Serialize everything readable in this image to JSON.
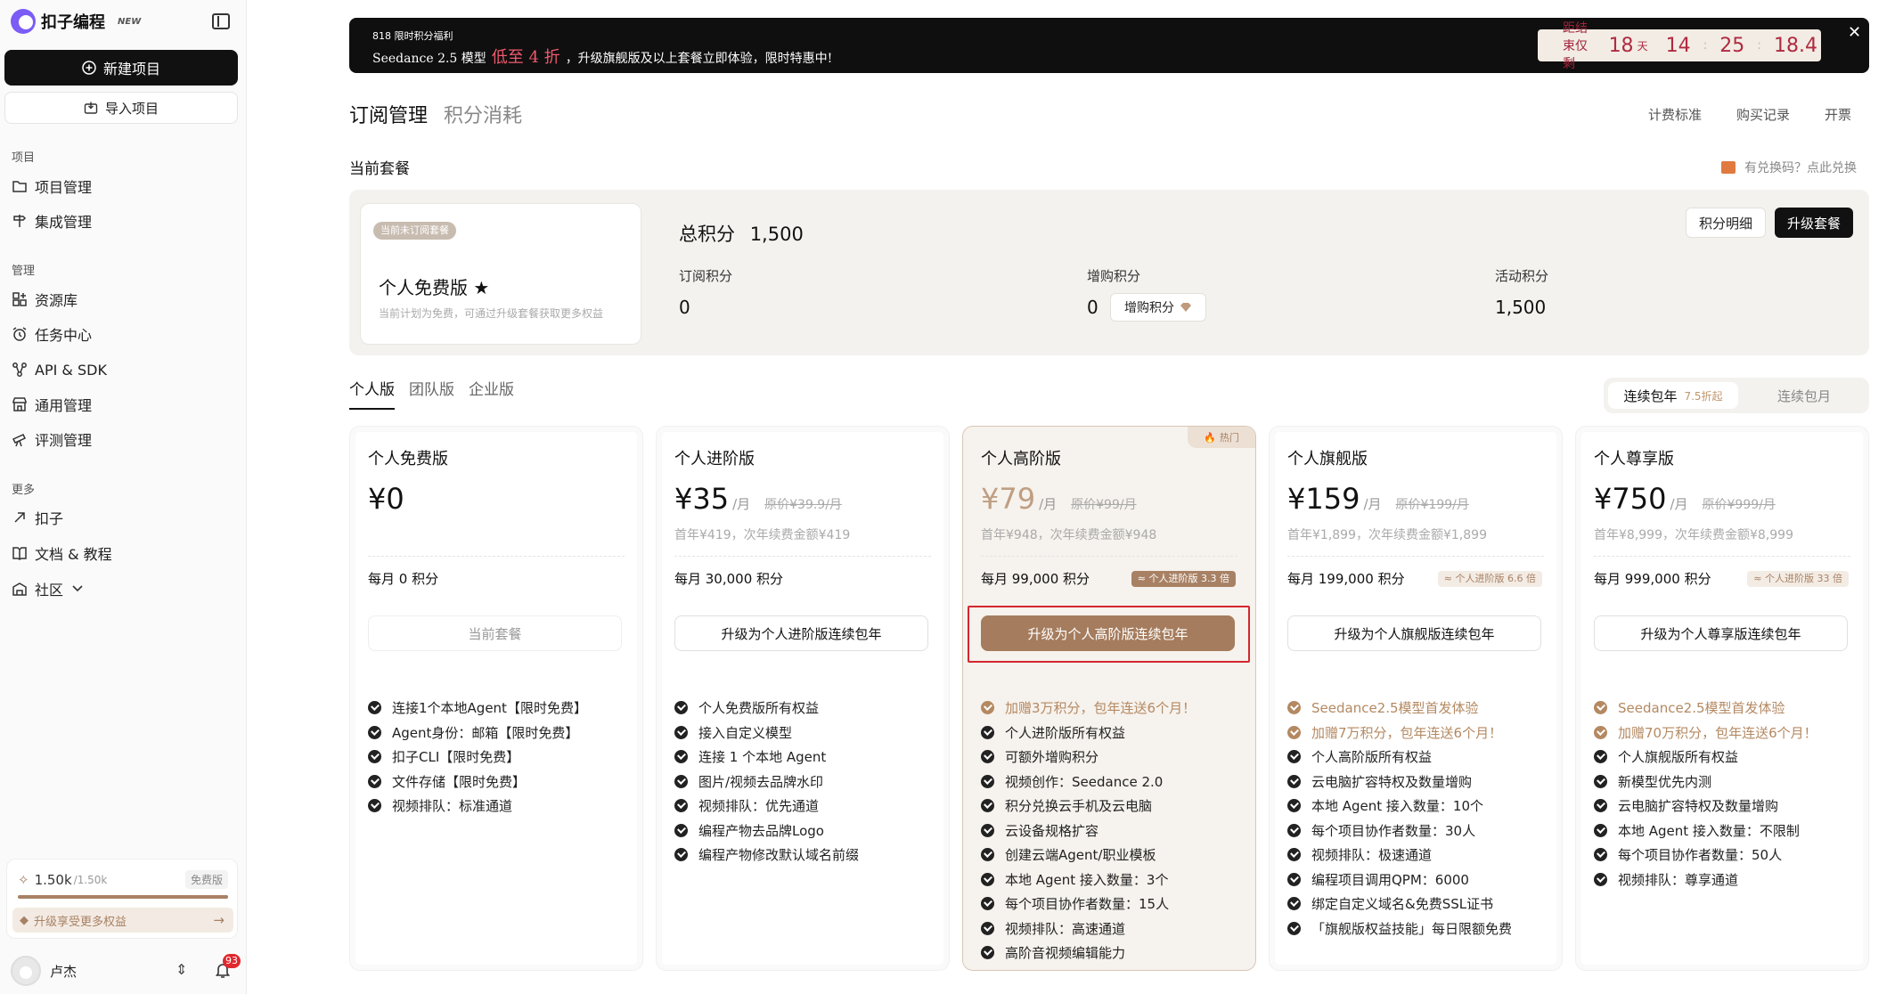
{
  "sidebar": {
    "brand": "扣子编程",
    "brand_badge": "NEW",
    "new_project": "新建项目",
    "import_project": "导入项目",
    "sections": [
      {
        "label": "项目",
        "items": [
          {
            "label": "项目管理",
            "icon": "folder-icon"
          },
          {
            "label": "集成管理",
            "icon": "signpost-icon"
          }
        ]
      },
      {
        "label": "管理",
        "items": [
          {
            "label": "资源库",
            "icon": "grid-plus-icon"
          },
          {
            "label": "任务中心",
            "icon": "alarm-clock-icon"
          },
          {
            "label": "API & SDK",
            "icon": "api-icon"
          },
          {
            "label": "通用管理",
            "icon": "storefront-icon"
          },
          {
            "label": "评测管理",
            "icon": "telescope-icon"
          }
        ]
      },
      {
        "label": "更多",
        "items": [
          {
            "label": "扣子",
            "icon": "arrow-up-right-icon"
          },
          {
            "label": "文档 & 教程",
            "icon": "book-open-icon"
          },
          {
            "label": "社区",
            "icon": "community-icon"
          }
        ]
      }
    ],
    "credits": {
      "used": "1.50k",
      "total": "/1.50k",
      "plan_tag": "免费版",
      "fill_fraction": 1.0,
      "upgrade_text": "升级享受更多权益"
    },
    "user": {
      "name": "卢杰",
      "notifications": "93"
    }
  },
  "banner": {
    "small_text": "818 限时积分福利",
    "line_prefix": "Seedance 2.5 模型",
    "line_highlight": "低至 4 折",
    "line_suffix": "，升级旗舰版及以上套餐立即体验，限时特惠中!",
    "timer_label": "距结束仅剩",
    "days": "18",
    "days_unit": "天",
    "hours": "14",
    "minutes": "25",
    "seconds": "18.4"
  },
  "page_tabs": {
    "active": "订阅管理",
    "inactive": "积分消耗"
  },
  "top_links": [
    "计费标准",
    "购买记录",
    "开票"
  ],
  "current_section": {
    "label": "当前套餐",
    "redeem": "有兑换码？点此兑换"
  },
  "current_plan": {
    "tag": "当前未订阅套餐",
    "title": "个人免费版 ★",
    "desc": "当前计划为免费，可通过升级套餐获取更多权益",
    "total_label": "总积分",
    "total_value": "1,500",
    "metrics": [
      {
        "label": "订阅积分",
        "value": "0"
      },
      {
        "label": "增购积分",
        "value": "0"
      },
      {
        "label": "活动积分",
        "value": "1,500"
      }
    ],
    "buy_button": "增购积分",
    "detail_button": "积分明细",
    "upgrade_button": "升级套餐"
  },
  "version_tabs": [
    "个人版",
    "团队版",
    "企业版"
  ],
  "billing": {
    "annual": "连续包年",
    "annual_discount": "7.5折起",
    "monthly": "连续包月"
  },
  "plans": [
    {
      "name": "个人免费版",
      "price": "¥0",
      "per": "",
      "orig": "",
      "renew": "",
      "points": "每月 0 积分",
      "mult": "",
      "cta": "当前套餐",
      "features": [
        {
          "t": "连接1个本地Agent【限时免费】",
          "a": false
        },
        {
          "t": "Agent身份：邮箱【限时免费】",
          "a": false
        },
        {
          "t": "扣子CLI【限时免费】",
          "a": false
        },
        {
          "t": "文件存储【限时免费】",
          "a": false
        },
        {
          "t": "视频排队：标准通道",
          "a": false
        }
      ]
    },
    {
      "name": "个人进阶版",
      "price": "¥35",
      "per": "/月",
      "orig": "原价¥39.9/月",
      "renew": "首年¥419，次年续费金额¥419",
      "points": "每月 30,000 积分",
      "mult": "",
      "cta": "升级为个人进阶版连续包年",
      "features": [
        {
          "t": "个人免费版所有权益",
          "a": false
        },
        {
          "t": "接入自定义模型",
          "a": false
        },
        {
          "t": "连接 1 个本地 Agent",
          "a": false
        },
        {
          "t": "图片/视频去品牌水印",
          "a": false
        },
        {
          "t": "视频排队：优先通道",
          "a": false
        },
        {
          "t": "编程产物去品牌Logo",
          "a": false
        },
        {
          "t": "编程产物修改默认域名前缀",
          "a": false
        }
      ]
    },
    {
      "name": "个人高阶版",
      "price": "¥79",
      "per": "/月",
      "orig": "原价¥99/月",
      "renew": "首年¥948，次年续费金额¥948",
      "points": "每月 99,000 积分",
      "mult": "≈ 个人进阶版 3.3 倍",
      "cta": "升级为个人高阶版连续包年",
      "hot": "热门",
      "features": [
        {
          "t": "加赠3万积分，包年连送6个月！",
          "a": true
        },
        {
          "t": "个人进阶版所有权益",
          "a": false
        },
        {
          "t": "可额外增购积分",
          "a": false
        },
        {
          "t": "视频创作：Seedance 2.0",
          "a": false
        },
        {
          "t": "积分兑换云手机及云电脑",
          "a": false
        },
        {
          "t": "云设备规格扩容",
          "a": false
        },
        {
          "t": "创建云端Agent/职业模板",
          "a": false
        },
        {
          "t": "本地 Agent 接入数量：3个",
          "a": false
        },
        {
          "t": "每个项目协作者数量：15人",
          "a": false
        },
        {
          "t": "视频排队：高速通道",
          "a": false
        },
        {
          "t": "高阶音视频编辑能力",
          "a": false
        }
      ]
    },
    {
      "name": "个人旗舰版",
      "price": "¥159",
      "per": "/月",
      "orig": "原价¥199/月",
      "renew": "首年¥1,899，次年续费金额¥1,899",
      "points": "每月 199,000 积分",
      "mult": "≈ 个人进阶版 6.6 倍",
      "cta": "升级为个人旗舰版连续包年",
      "features": [
        {
          "t": "Seedance2.5模型首发体验",
          "a": true
        },
        {
          "t": "加赠7万积分，包年连送6个月！",
          "a": true
        },
        {
          "t": "个人高阶版所有权益",
          "a": false
        },
        {
          "t": "云电脑扩容特权及数量增购",
          "a": false
        },
        {
          "t": "本地 Agent 接入数量：10个",
          "a": false
        },
        {
          "t": "每个项目协作者数量：30人",
          "a": false
        },
        {
          "t": "视频排队：极速通道",
          "a": false
        },
        {
          "t": "编程项目调用QPM：6000",
          "a": false
        },
        {
          "t": "绑定自定义域名&免费SSL证书",
          "a": false
        },
        {
          "t": "「旗舰版权益技能」每日限额免费",
          "a": false
        }
      ]
    },
    {
      "name": "个人尊享版",
      "price": "¥750",
      "per": "/月",
      "orig": "原价¥999/月",
      "renew": "首年¥8,999，次年续费金额¥8,999",
      "points": "每月 999,000 积分",
      "mult": "≈ 个人进阶版 33 倍",
      "cta": "升级为个人尊享版连续包年",
      "features": [
        {
          "t": "Seedance2.5模型首发体验",
          "a": true
        },
        {
          "t": "加赠70万积分，包年连送6个月！",
          "a": true
        },
        {
          "t": "个人旗舰版所有权益",
          "a": false
        },
        {
          "t": "新模型优先内测",
          "a": false
        },
        {
          "t": "云电脑扩容特权及数量增购",
          "a": false
        },
        {
          "t": "本地 Agent 接入数量：不限制",
          "a": false
        },
        {
          "t": "每个项目协作者数量：50人",
          "a": false
        },
        {
          "t": "视频排队：尊享通道",
          "a": false
        }
      ]
    }
  ]
}
